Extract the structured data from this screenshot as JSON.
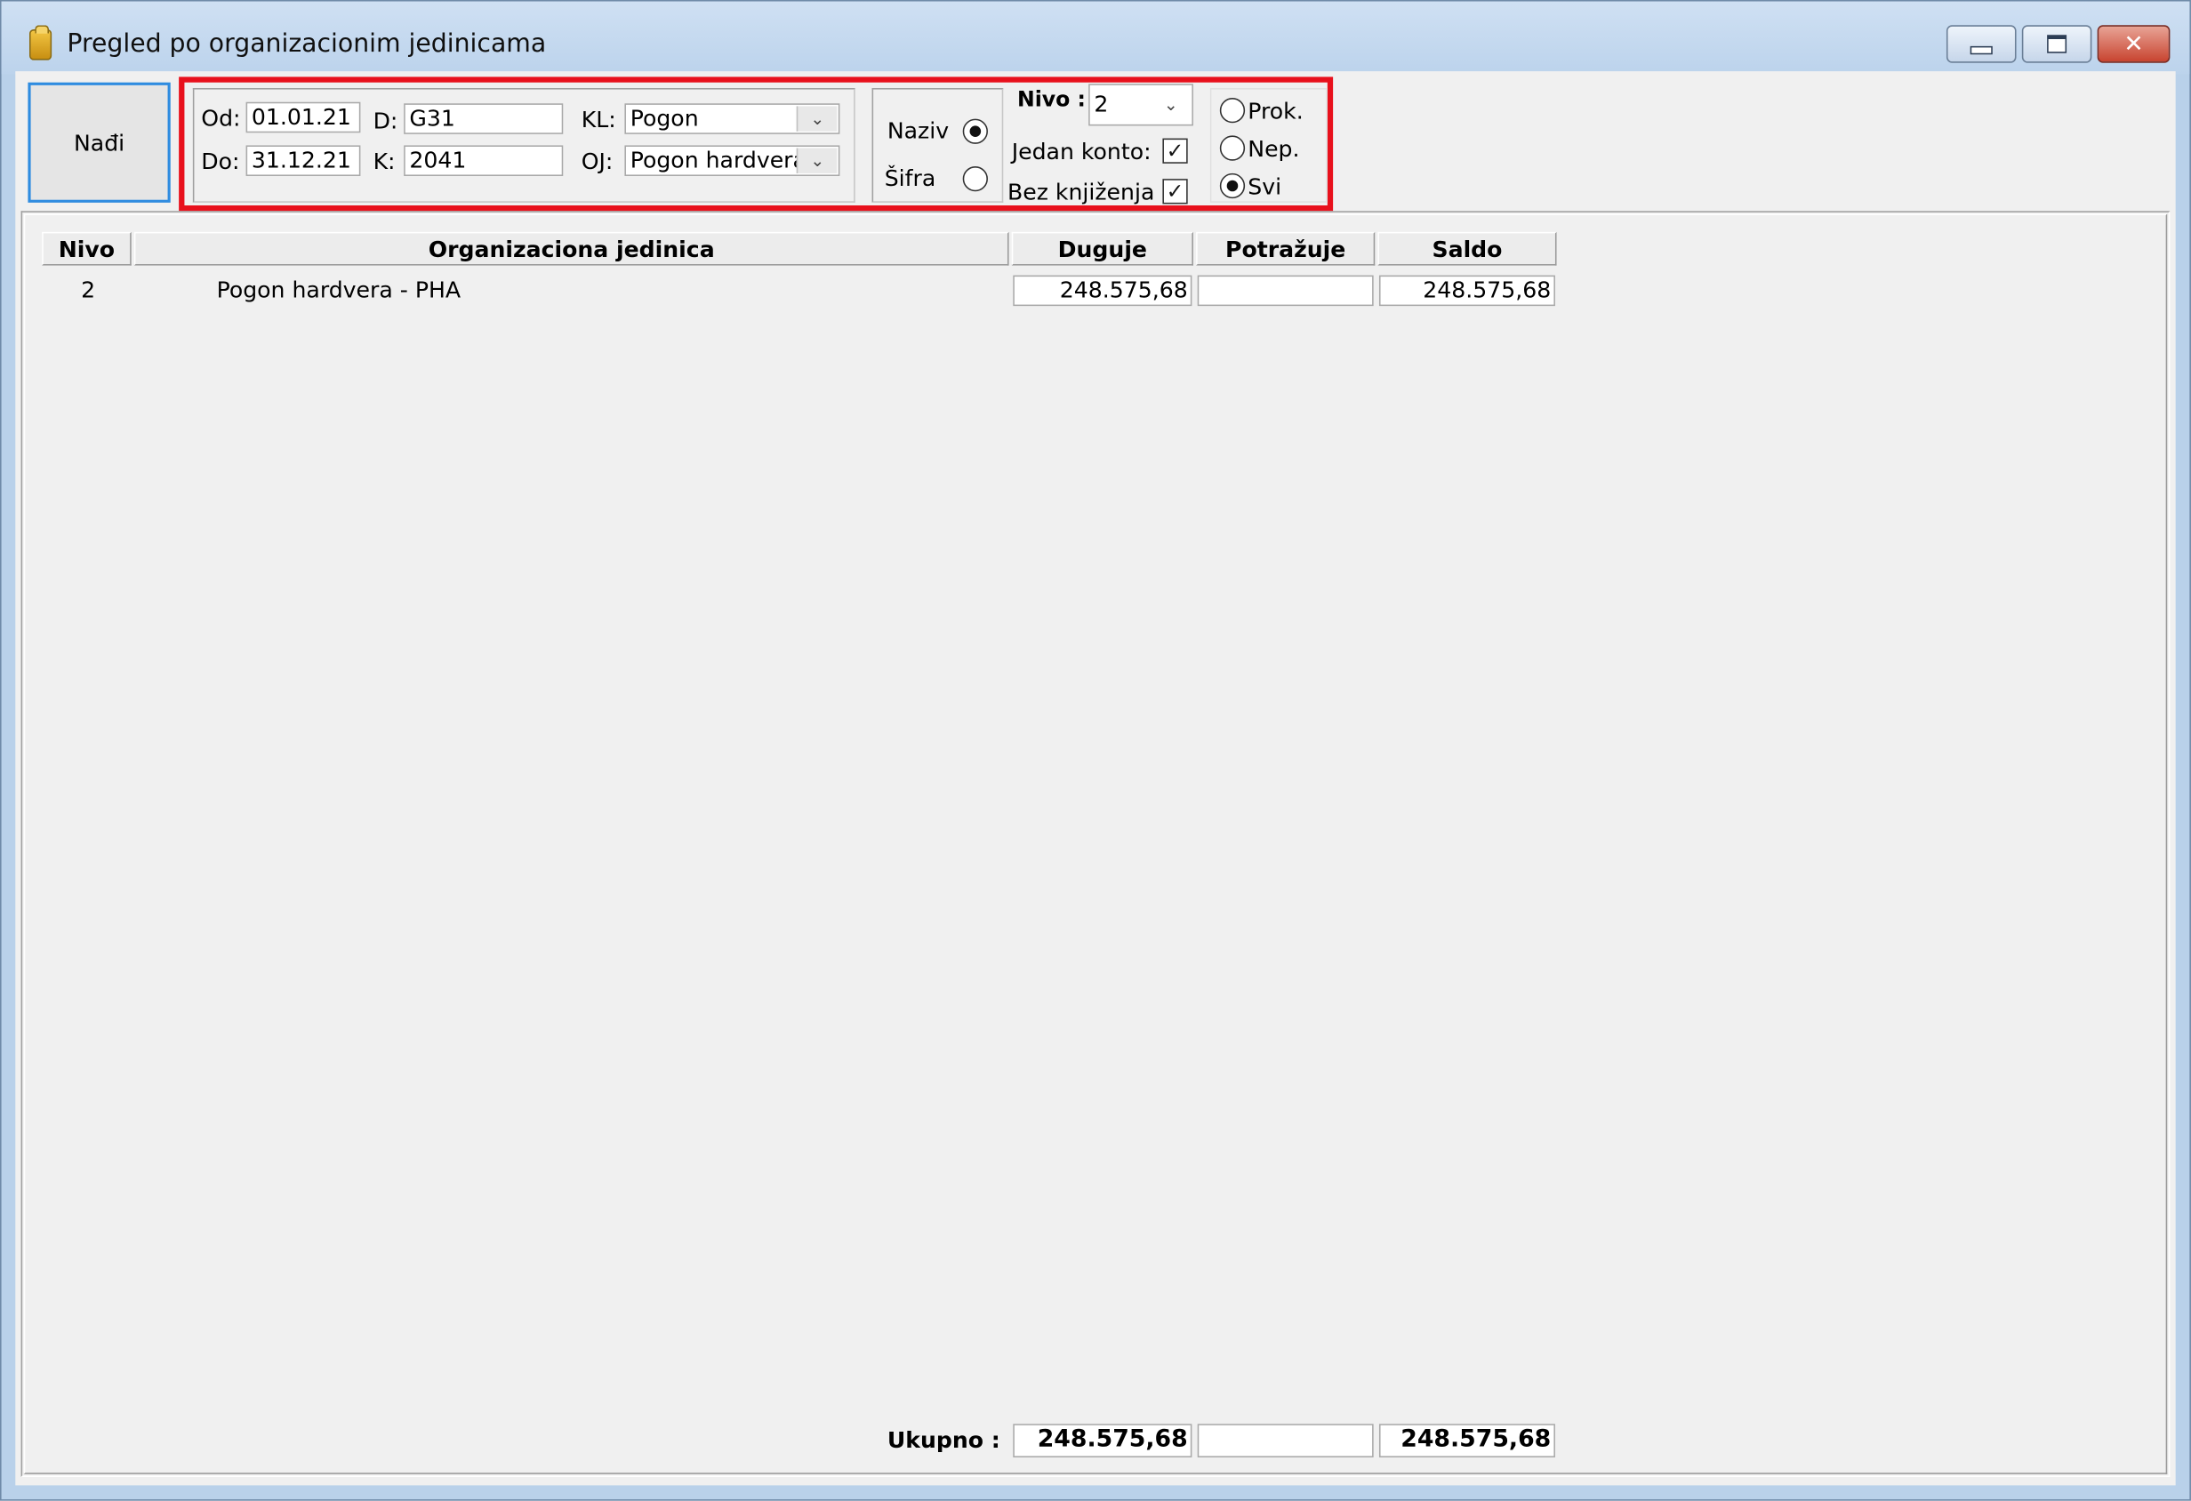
{
  "window": {
    "title": "Pregled po organizacionim jedinicama",
    "controls": {
      "minimize": "minimize",
      "maximize": "maximize",
      "close": "✕"
    }
  },
  "toolbar": {
    "find_label": "Nađi"
  },
  "filters": {
    "from_label": "Od:",
    "from_value": "01.01.21",
    "to_label": "Do:",
    "to_value": "31.12.21",
    "d_label": "D:",
    "d_value": "G31",
    "k_label": "K:",
    "k_value": "2041",
    "kl_label": "KL:",
    "kl_value": "Pogon",
    "oj_label": "OJ:",
    "oj_value": "Pogon hardvera",
    "display_by": {
      "naziv_label": "Naziv",
      "sifra_label": "Šifra",
      "selected": "Naziv"
    },
    "nivo_label": "Nivo :",
    "nivo_value": "2",
    "jedan_konto_label": "Jedan konto:",
    "jedan_konto_checked": true,
    "bez_knjizenja_label": "Bez knjiženja",
    "bez_knjizenja_checked": true,
    "status": {
      "prok_label": "Prok.",
      "nep_label": "Nep.",
      "svi_label": "Svi",
      "selected": "Svi"
    }
  },
  "table": {
    "columns": [
      "Nivo",
      "Organizaciona jedinica",
      "Duguje",
      "Potražuje",
      "Saldo"
    ],
    "rows": [
      {
        "nivo": "2",
        "jedinica": "Pogon hardvera - PHA",
        "duguje": "248.575,68",
        "potrazuje": "",
        "saldo": "248.575,68"
      }
    ]
  },
  "totals": {
    "label": "Ukupno :",
    "duguje": "248.575,68",
    "potrazuje": "",
    "saldo": "248.575,68"
  },
  "colors": {
    "highlight_frame": "#e8101c",
    "focus_border": "#2f8ce0",
    "window_bg": "#f0f0f0",
    "titlebar": "#c4d8ef"
  }
}
